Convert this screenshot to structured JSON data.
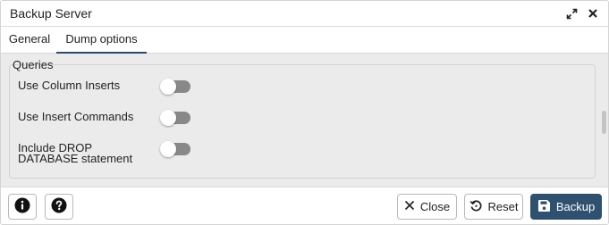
{
  "dialog": {
    "title": "Backup Server",
    "icons": {
      "expand": "expand-icon",
      "close": "close-icon"
    }
  },
  "tabs": [
    {
      "label": "General",
      "active": false
    },
    {
      "label": "Dump options",
      "active": true
    }
  ],
  "section": {
    "title": "Queries",
    "fields": [
      {
        "label": "Use Column Inserts",
        "enabled": false
      },
      {
        "label": "Use Insert Commands",
        "enabled": false
      },
      {
        "label_line1": "Include DROP",
        "label_line2": "DATABASE statement",
        "enabled": false
      }
    ]
  },
  "footer": {
    "info_icon": "info-icon",
    "help_icon": "help-icon",
    "close_label": "Close",
    "reset_label": "Reset",
    "backup_label": "Backup"
  },
  "colors": {
    "primary": "#30506f",
    "tab_active_underline": "#2c4a6e",
    "toggle_off": "#888888",
    "body_bg": "#ebebeb"
  }
}
